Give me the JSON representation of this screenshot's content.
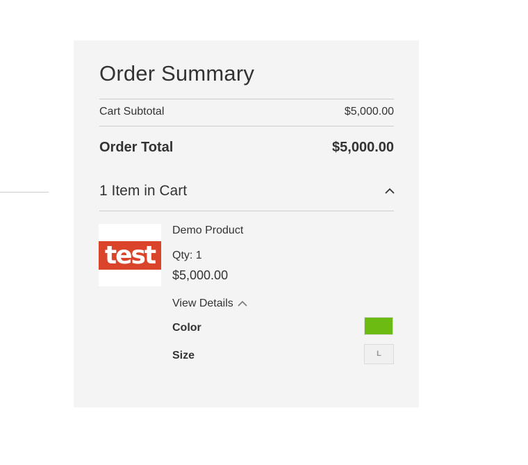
{
  "summary": {
    "title": "Order Summary",
    "subtotal_label": "Cart Subtotal",
    "subtotal_value": "$5,000.00",
    "total_label": "Order Total",
    "total_value": "$5,000.00",
    "items_header": "1 Item in Cart",
    "items_toggle_icon": "chevron-up-icon"
  },
  "item": {
    "thumbnail_text": "test",
    "name": "Demo Product",
    "qty": "Qty: 1",
    "price": "$5,000.00",
    "view_details": "View Details",
    "view_details_icon": "chevron-up-icon",
    "options": [
      {
        "label": "Color",
        "swatch_color": "#6cbb13"
      },
      {
        "label": "Size",
        "value": "L"
      }
    ]
  },
  "colors": {
    "panel_bg": "#f4f4f4",
    "thumbnail_accent": "#d9442b",
    "color_swatch": "#6cbb13"
  }
}
